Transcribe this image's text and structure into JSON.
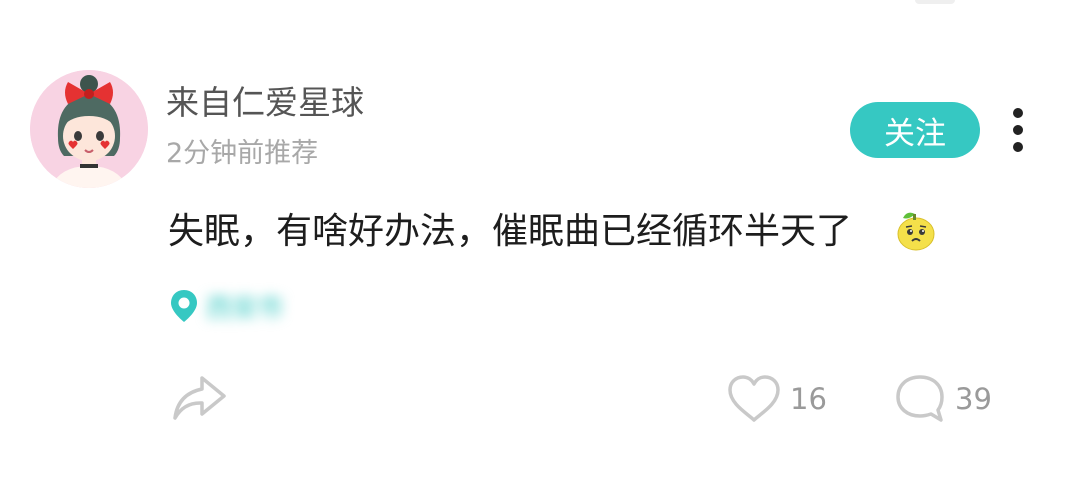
{
  "post": {
    "user": {
      "name": "来自仁爱星球",
      "avatar_icon": "cartoon-girl-avatar"
    },
    "timestamp": "2分钟前推荐",
    "follow_label": "关注",
    "more_icon": "more-vertical-icon",
    "content": "失眠，有啥好办法，催眠曲已经循环半天了",
    "emoji_icon": "worried-lemon-emoji",
    "location": {
      "icon": "location-pin-icon",
      "text": "西安市"
    },
    "actions": {
      "share_icon": "share-arrow-icon",
      "like_icon": "heart-icon",
      "like_count": "16",
      "comment_icon": "comment-bubble-icon",
      "comment_count": "39"
    }
  },
  "colors": {
    "accent": "#36c8c2",
    "username": "#555555",
    "timestamp": "#a8a8a8",
    "icon_gray": "#c9c9c9",
    "count_gray": "#9a9a9a"
  }
}
